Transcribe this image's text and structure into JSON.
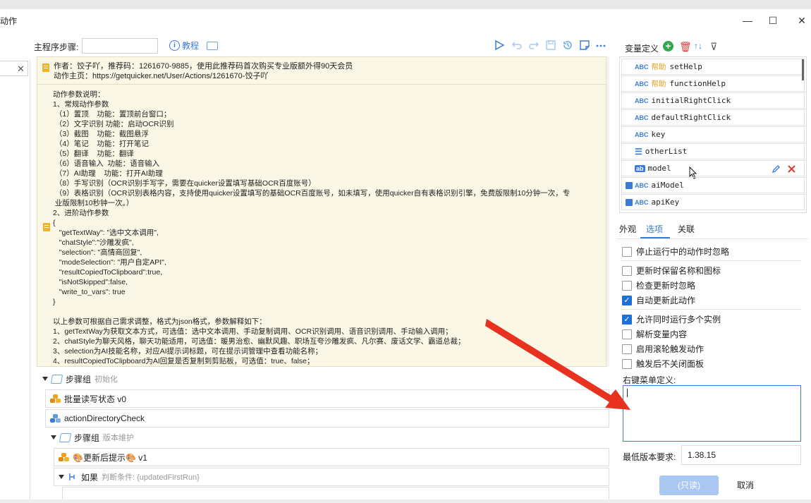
{
  "window": {
    "title": "动作",
    "minimize": "—",
    "maximize": "☐",
    "close": "✕"
  },
  "left": {
    "close_icon": "✕"
  },
  "toolbar": {
    "main_step_label": "主程序步骤:",
    "tutorial": "教程",
    "icons": [
      "play-icon",
      "undo-icon",
      "redo-icon",
      "save-icon",
      "history-icon",
      "note-icon",
      "more-icon"
    ]
  },
  "editor": {
    "author_line": "作者：饺子吖，推荐码：1261670-9885，使用此推荐码首次购买专业版额外得90天会员",
    "homepage_line": "动作主页：https://getquicker.net/User/Actions/1261670-饺子吖",
    "body": "动作参数说明：\n1、常规动作参数\n （1）置顶    功能：置顶前台窗口；\n （2）文字识别 功能：启动OCR识别\n （3）截图    功能：截图悬浮\n （4）笔记    功能：打开笔记\n （5）翻译    功能：翻译\n （6）语音输入  功能：语音输入\n （7）AI助理    功能：打开AI助理\n （8）手写识别（OCR识别手写字，需要在quicker设置填写基础OCR百度账号）\n （9）表格识别（OCR识别表格内容，支持使用quicker设置填写的基础OCR百度账号，如未填写，使用quicker自有表格识别引擎，免费版限制10分钟一次，专\n 业版限制10秒钟一次。）\n2、进阶动作参数\n{\n   \"getTextWay\": \"选中文本调用\",\n   \"chatStyle\":\"沙雕发疯\",\n   \"selection\": \"高情商回复\",\n   \"modeSelection\": \"用户自定API\",\n   \"resultCopiedToClipboard\":true,\n   \"isNotSkipped\":false,\n   \"write_to_vars\": true\n}\n\n以上参数可根据自己需求调整，格式为json格式，参数解释如下：\n1、getTextWay为获取文本方式，可选值：选中文本调用、手动复制调用、OCR识别调用、语音识别调用、手动输入调用；\n2、chatStyle为聊天风格，聊天功能适用，可选值：暖男治愈、幽默风趣、职场互夸沙雕发疯、凡尔赛、废话文学、霸道总裁；\n3、selection为AI技能名称，对应AI提示词标题，可在提示词管理中查看功能名称；\n4、resultCopiedToClipboard为AI回复是否复制到剪贴板，可选值：true、false；"
  },
  "steps": {
    "group1_label": "步骤组",
    "group1_sub": "初始化",
    "row1": "批量读写状态 v0",
    "row2": "actionDirectoryCheck",
    "group2_label": "步骤组",
    "group2_sub": "版本维护",
    "row3": "🎨更新后提示🎨 v1",
    "if_label": "如果",
    "if_sub": "判断条件: {updatedFirstRun}"
  },
  "variables": {
    "title": "变量定义",
    "add_icon": "+",
    "delete_icon": "🗑",
    "sort_icon": "↑↓",
    "filter_icon": "⊽",
    "items": [
      {
        "type": "ABC",
        "tag": "帮助",
        "name": "setHelp"
      },
      {
        "type": "ABC",
        "tag": "帮助",
        "name": "functionHelp"
      },
      {
        "type": "ABC",
        "tag": "",
        "name": "initialRightClick"
      },
      {
        "type": "ABC",
        "tag": "",
        "name": "defaultRightClick"
      },
      {
        "type": "ABC",
        "tag": "",
        "name": "key"
      },
      {
        "type": "☰",
        "tag": "",
        "name": "otherList"
      },
      {
        "type": "ab",
        "tag": "",
        "name": "model"
      },
      {
        "type": "ABC",
        "tag": "",
        "name": "aiModel"
      },
      {
        "type": "ABC",
        "tag": "",
        "name": "apiKey"
      }
    ]
  },
  "tabs": [
    {
      "label": "外观"
    },
    {
      "label": "选项"
    },
    {
      "label": "关联"
    }
  ],
  "options": [
    {
      "label": "停止运行中的动作时忽略",
      "checked": false
    },
    {
      "label": "更新时保留名称和图标",
      "checked": false
    },
    {
      "label": "检查更新时忽略",
      "checked": false
    },
    {
      "label": "自动更新此动作",
      "checked": true
    },
    {
      "label": "允许同时运行多个实例",
      "checked": true
    },
    {
      "label": "解析变量内容",
      "checked": false
    },
    {
      "label": "启用滚轮触发动作",
      "checked": false
    },
    {
      "label": "触发后不关闭面板",
      "checked": false
    }
  ],
  "context_menu": {
    "label": "右键菜单定义:"
  },
  "min_version": {
    "label": "最低版本要求:",
    "value": "1.38.15"
  },
  "buttons": {
    "readonly": "(只读)",
    "cancel": "取消"
  },
  "colors": {
    "accent": "#3a7bd5",
    "arrow": "#e8321f",
    "note_bg": "#fbf7e6"
  }
}
